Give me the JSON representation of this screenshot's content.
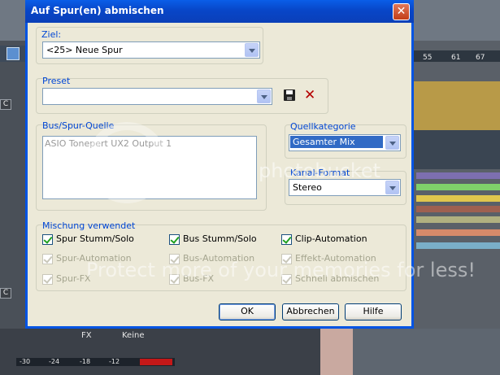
{
  "dialog": {
    "title": "Auf Spur(en) abmischen",
    "close_icon": "close-icon"
  },
  "ziel": {
    "label": "Ziel:",
    "value": "<25> Neue Spur"
  },
  "preset": {
    "label": "Preset",
    "value": "",
    "save_icon": "save-icon",
    "delete_icon": "delete-icon"
  },
  "source": {
    "label": "Bus/Spur-Quelle",
    "items": [
      "ASIO Tonepert UX2 Output 1"
    ]
  },
  "quellkategorie": {
    "label": "Quellkategorie",
    "value": "Gesamter Mix"
  },
  "kanalformat": {
    "label": "Kanal-Format",
    "value": "Stereo"
  },
  "mischung": {
    "label": "Mischung verwendet",
    "checkboxes": [
      {
        "label": "Spur Stumm/Solo",
        "checked": true,
        "enabled": true
      },
      {
        "label": "Bus Stumm/Solo",
        "checked": true,
        "enabled": true
      },
      {
        "label": "Clip-Automation",
        "checked": true,
        "enabled": true
      },
      {
        "label": "Spur-Automation",
        "checked": true,
        "enabled": false
      },
      {
        "label": "Bus-Automation",
        "checked": true,
        "enabled": false
      },
      {
        "label": "Effekt-Automation",
        "checked": true,
        "enabled": false
      },
      {
        "label": "Spur-FX",
        "checked": true,
        "enabled": false
      },
      {
        "label": "Bus-FX",
        "checked": true,
        "enabled": false
      },
      {
        "label": "Schnell abmischen",
        "checked": true,
        "enabled": false
      }
    ]
  },
  "buttons": {
    "ok": "OK",
    "cancel": "Abbrechen",
    "help": "Hilfe"
  },
  "background": {
    "ruler_ticks": [
      "55",
      "61",
      "67"
    ],
    "fx_label": "FX",
    "fx_value": "Keine",
    "meter_ticks": [
      "-30",
      "-24",
      "-18",
      "-12"
    ],
    "track_buttons": [
      "C",
      "C",
      "C"
    ]
  },
  "watermark": {
    "brand": "photobucket",
    "line": "Protect more of your memories for less!"
  },
  "colors": {
    "title_bar": "#0846c8",
    "dialog_bg": "#ece9d8",
    "group_label": "#0046d5",
    "selection": "#316ac5"
  }
}
